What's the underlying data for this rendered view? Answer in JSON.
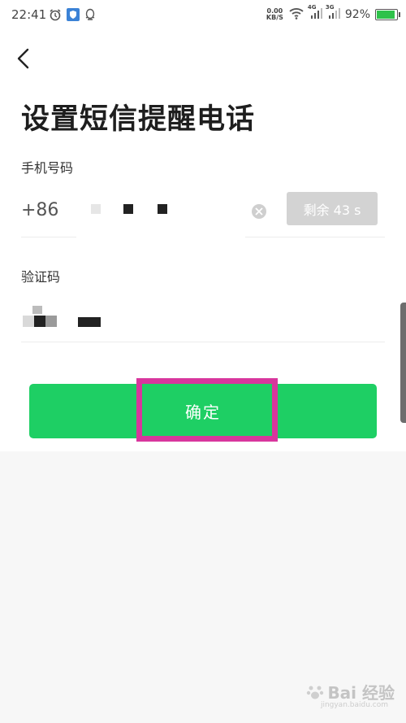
{
  "status_bar": {
    "time": "22:41",
    "net_speed_value": "0.00",
    "net_speed_unit": "KB/S",
    "signal_1": "4G",
    "signal_2": "3G",
    "battery": "92%",
    "battery_level": 0.92
  },
  "page": {
    "title": "设置短信提醒电话"
  },
  "phone": {
    "label": "手机号码",
    "country_code": "+86",
    "resend_label": "剩余 43 s"
  },
  "code": {
    "label": "验证码"
  },
  "actions": {
    "confirm_label": "确定"
  },
  "watermark": {
    "brand": "Bai 经验",
    "url": "jingyan.baidu.com"
  },
  "colors": {
    "primary": "#1ecf64",
    "highlight": "#d8369d",
    "disabled": "#d3d3d3"
  }
}
